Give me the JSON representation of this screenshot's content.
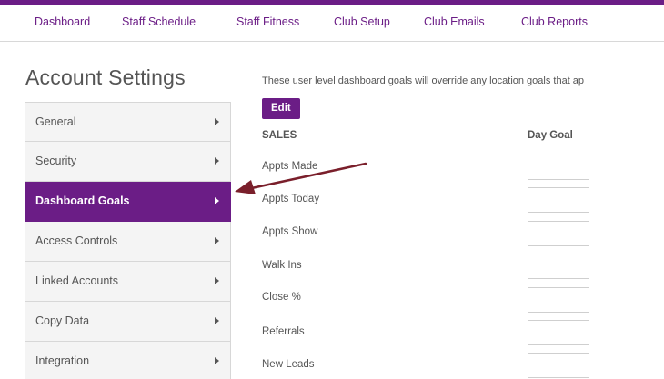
{
  "nav": {
    "items": [
      "Dashboard",
      "Staff Schedule",
      "Staff Fitness",
      "Club Setup",
      "Club Emails",
      "Club Reports"
    ]
  },
  "page": {
    "title": "Account Settings",
    "intro": "These user level dashboard goals will override any location goals that ap"
  },
  "sidebar": {
    "items": [
      {
        "label": "General"
      },
      {
        "label": "Security"
      },
      {
        "label": "Dashboard Goals",
        "active": true
      },
      {
        "label": "Access Controls"
      },
      {
        "label": "Linked Accounts"
      },
      {
        "label": "Copy Data"
      },
      {
        "label": "Integration"
      }
    ]
  },
  "goals": {
    "edit_label": "Edit",
    "section_header": "SALES",
    "column_header": "Day Goal",
    "rows": [
      {
        "label": "Appts Made",
        "value": ""
      },
      {
        "label": "Appts Today",
        "value": ""
      },
      {
        "label": "Appts Show",
        "value": ""
      },
      {
        "label": "Walk Ins",
        "value": ""
      },
      {
        "label": "Close %",
        "value": ""
      },
      {
        "label": "Referrals",
        "value": ""
      },
      {
        "label": "New Leads",
        "value": ""
      }
    ]
  },
  "colors": {
    "accent": "#6b1d86",
    "annotation_arrow": "#7a1f2b"
  }
}
